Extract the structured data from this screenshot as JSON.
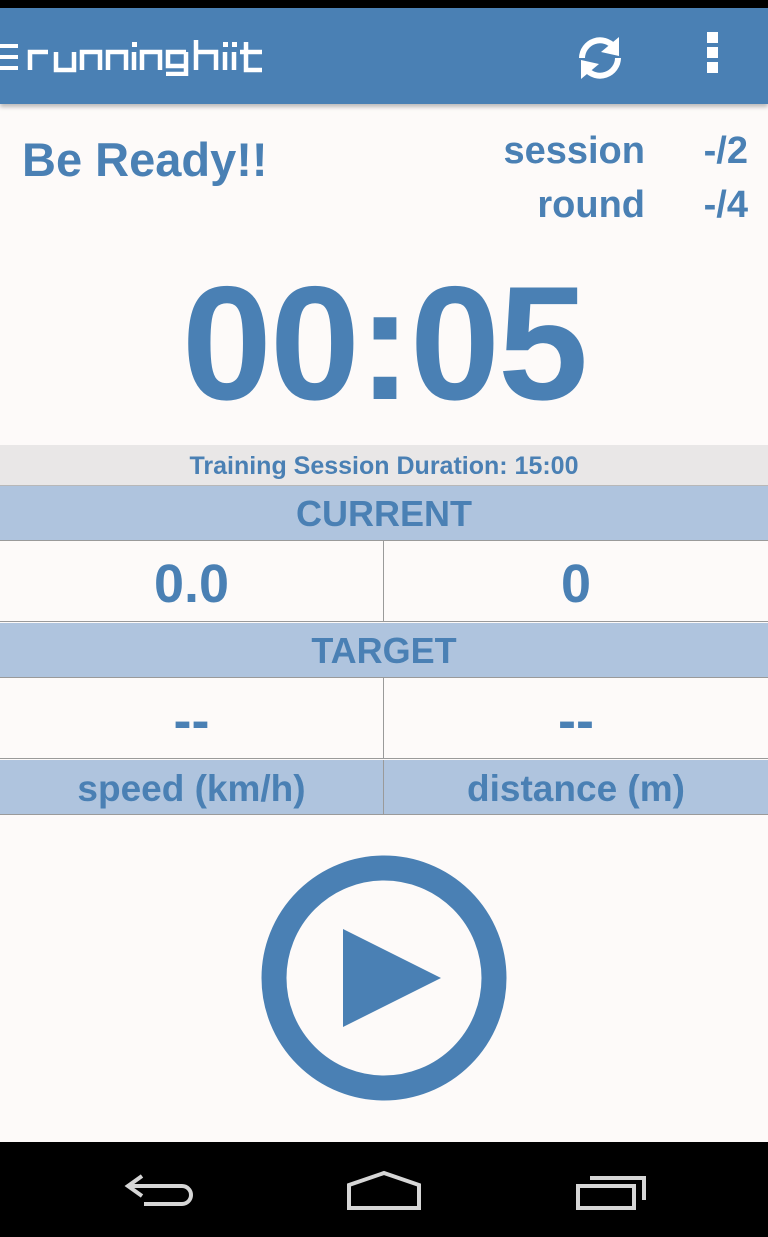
{
  "app": {
    "logo_text": "runninghiit",
    "accent_color": "#4a80b4",
    "header_band_color": "#afc4de",
    "background_color": "#fdfaf9"
  },
  "toolbar": {
    "menu_icon": "hamburger-icon",
    "refresh_icon": "refresh-icon",
    "overflow_icon": "overflow-menu-icon"
  },
  "status": {
    "title": "Be Ready!!"
  },
  "counters": {
    "session_label": "session",
    "session_value": "-/2",
    "round_label": "round",
    "round_value": "-/4"
  },
  "timer": {
    "display": "00:05"
  },
  "training": {
    "duration_text": "Training Session Duration: 15:00"
  },
  "current": {
    "header": "CURRENT",
    "speed_value": "0.0",
    "distance_value": "0"
  },
  "target": {
    "header": "TARGET",
    "speed_value": "--",
    "distance_value": "--"
  },
  "units": {
    "speed": "speed (km/h)",
    "distance": "distance (m)"
  },
  "controls": {
    "play_icon": "play-icon"
  },
  "navigation": {
    "back_icon": "back-icon",
    "home_icon": "home-icon",
    "recents_icon": "recent-apps-icon"
  }
}
